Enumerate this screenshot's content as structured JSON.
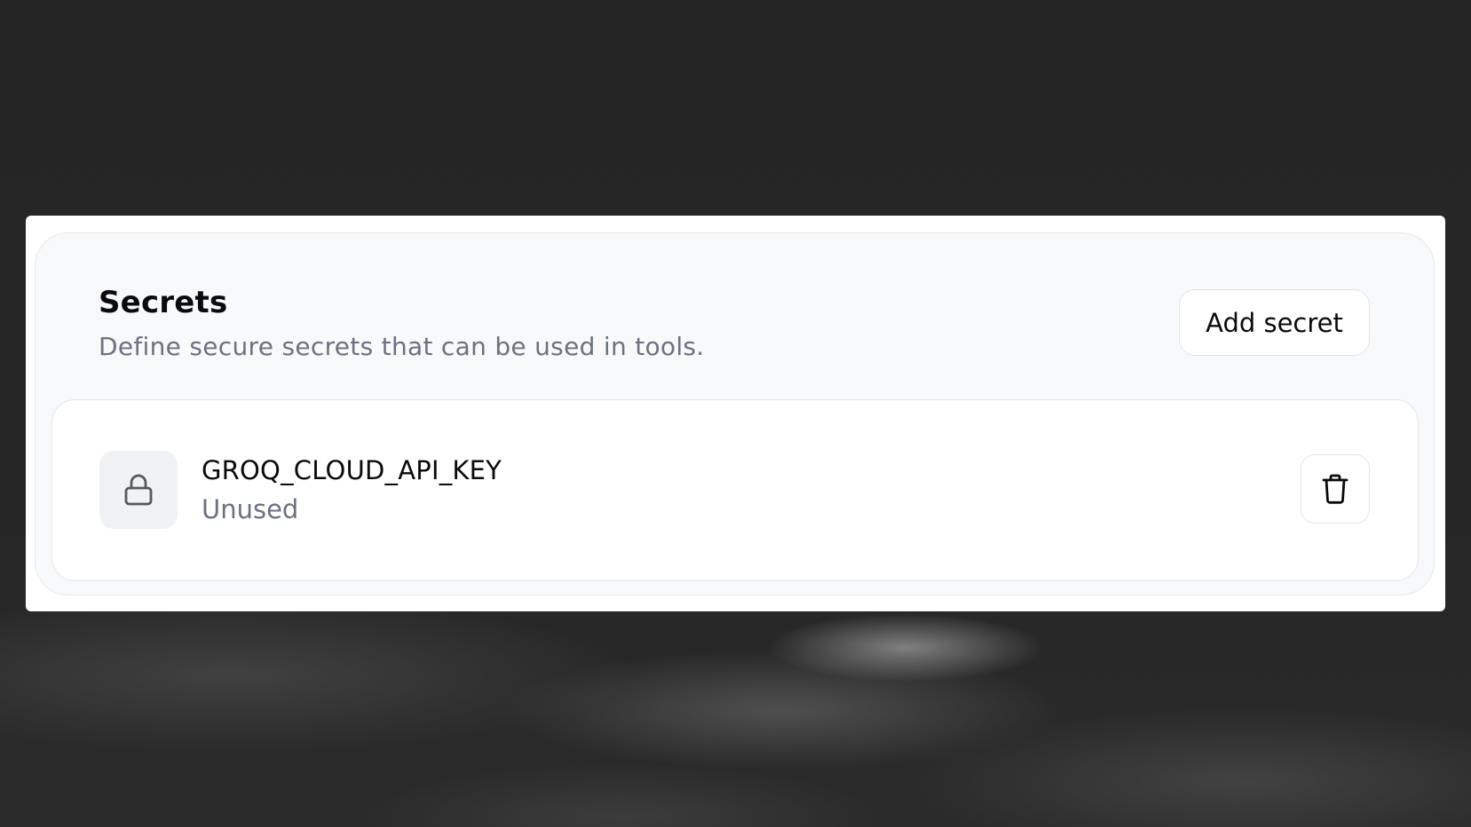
{
  "secrets_panel": {
    "title": "Secrets",
    "description": "Define secure secrets that can be used in tools.",
    "add_button_label": "Add secret"
  },
  "secrets": [
    {
      "name": "GROQ_CLOUD_API_KEY",
      "status": "Unused",
      "icon": "lock-icon",
      "action_icon": "trash-icon"
    }
  ]
}
